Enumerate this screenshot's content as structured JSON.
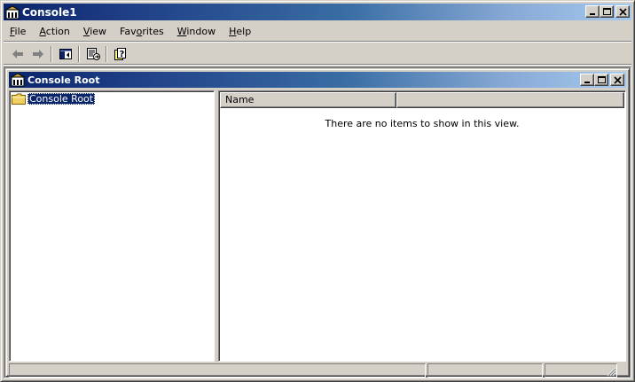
{
  "app": {
    "title": "Console1"
  },
  "menu": [
    {
      "label": "File",
      "accel": "F",
      "rest": "ile"
    },
    {
      "label": "Action",
      "accel": "A",
      "rest": "ction"
    },
    {
      "label": "View",
      "accel": "V",
      "rest": "iew"
    },
    {
      "label": "Favorites",
      "accel": "",
      "pre": "Fav",
      "accel_mid": "o",
      "post": "rites"
    },
    {
      "label": "Window",
      "accel": "W",
      "rest": "indow"
    },
    {
      "label": "Help",
      "accel": "H",
      "rest": "elp"
    }
  ],
  "child_window": {
    "title": "Console Root"
  },
  "tree": {
    "root_label": "Console Root"
  },
  "list": {
    "columns": [
      "Name"
    ],
    "empty_message": "There are no items to show in this view."
  },
  "colors": {
    "title_active_start": "#0a246a",
    "title_active_end": "#a6caf0",
    "face": "#d4d0c8",
    "selection": "#0a246a"
  }
}
